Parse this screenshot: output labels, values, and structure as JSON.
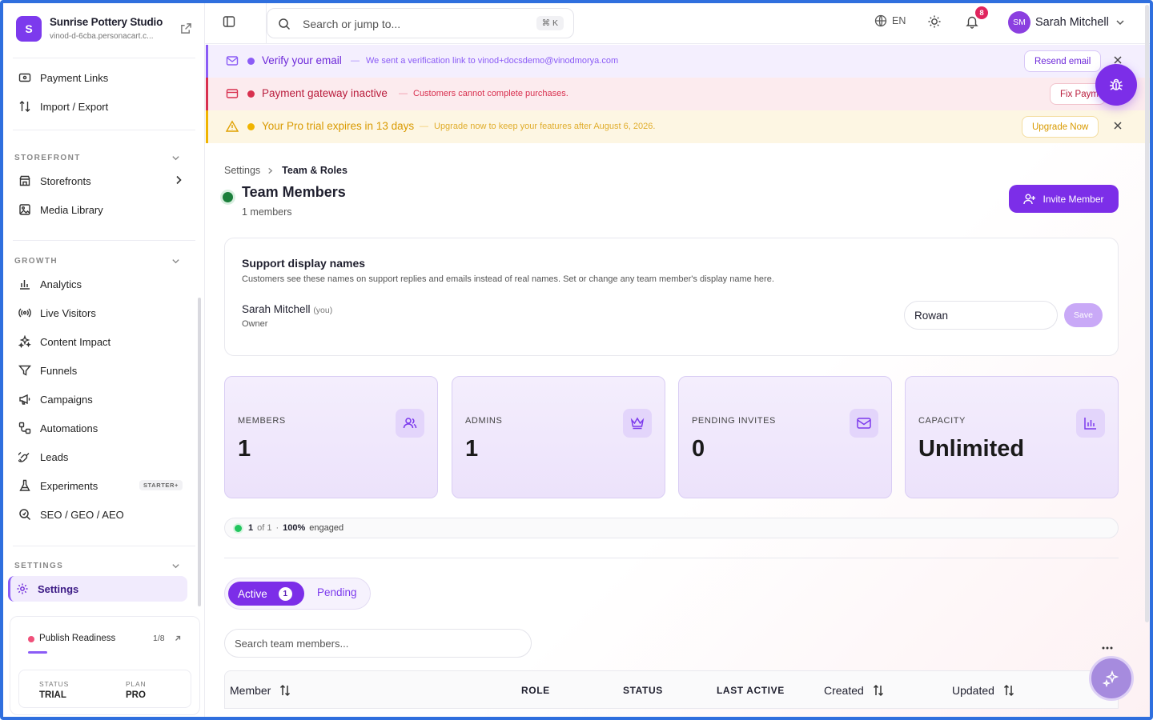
{
  "brand": {
    "initial": "S",
    "name": "Sunrise Pottery Studio",
    "url": "vinod-d-6cba.personacart.c..."
  },
  "sidebar": {
    "top_items": [
      {
        "label": "Payment Links"
      },
      {
        "label": "Import / Export"
      }
    ],
    "storefront": {
      "label": "STOREFRONT",
      "items": [
        {
          "label": "Storefronts"
        },
        {
          "label": "Media Library"
        }
      ]
    },
    "growth": {
      "label": "GROWTH",
      "items": [
        {
          "label": "Analytics"
        },
        {
          "label": "Live Visitors"
        },
        {
          "label": "Content Impact"
        },
        {
          "label": "Funnels"
        },
        {
          "label": "Campaigns"
        },
        {
          "label": "Automations"
        },
        {
          "label": "Leads"
        },
        {
          "label": "Experiments",
          "tag": "STARTER+"
        },
        {
          "label": "SEO / GEO / AEO"
        }
      ]
    },
    "settings": {
      "label": "SETTINGS",
      "items": [
        {
          "label": "Settings"
        }
      ]
    },
    "publish": {
      "title": "Publish Readiness",
      "count": "1/8",
      "progress_fraction": 0.125,
      "status_label": "STATUS",
      "status_value": "TRIAL",
      "plan_label": "PLAN",
      "plan_value": "PRO"
    }
  },
  "topbar": {
    "search_placeholder": "Search or jump to...",
    "shortcut": "⌘ K",
    "language": "EN",
    "notifications": "8",
    "user_initials": "SM",
    "user_name": "Sarah Mitchell"
  },
  "banners": {
    "verify": {
      "title": "Verify your email",
      "dash": "—",
      "text": "We sent a verification link to vinod+docsdemo@vinodmorya.com",
      "button": "Resend email"
    },
    "gateway": {
      "title": "Payment gateway inactive",
      "dash": "—",
      "text": "Customers cannot complete purchases.",
      "button": "Fix Paym"
    },
    "trial": {
      "title": "Your Pro trial expires in 13 days",
      "dash": "—",
      "text": "Upgrade now to keep your features after August 6, 2026.",
      "button": "Upgrade Now"
    }
  },
  "page": {
    "breadcrumb_parent": "Settings",
    "breadcrumb_current": "Team & Roles",
    "title": "Team Members",
    "subtitle": "1 members",
    "invite_button": "Invite Member"
  },
  "display_names": {
    "title": "Support display names",
    "description": "Customers see these names on support replies and emails instead of real names. Set or change any team member's display name here.",
    "member_name": "Sarah Mitchell",
    "member_you": "(you)",
    "member_role": "Owner",
    "input_value": "Rowan",
    "save_button": "Save"
  },
  "stats": [
    {
      "label": "MEMBERS",
      "value": "1"
    },
    {
      "label": "ADMINS",
      "value": "1"
    },
    {
      "label": "PENDING INVITES",
      "value": "0"
    },
    {
      "label": "CAPACITY",
      "value": "Unlimited"
    }
  ],
  "engagement": {
    "count": "1",
    "of": "of 1",
    "dot": "·",
    "percent": "100%",
    "label": "engaged"
  },
  "tabs": {
    "active_label": "Active",
    "active_count": "1",
    "pending_label": "Pending"
  },
  "table": {
    "search_placeholder": "Search team members...",
    "columns": {
      "member": "Member",
      "role": "ROLE",
      "status": "STATUS",
      "last_active": "LAST ACTIVE",
      "created": "Created",
      "updated": "Updated"
    }
  },
  "colors": {
    "accent": "#7c2ee8",
    "danger": "#d8304f",
    "warning": "#f0b400"
  }
}
